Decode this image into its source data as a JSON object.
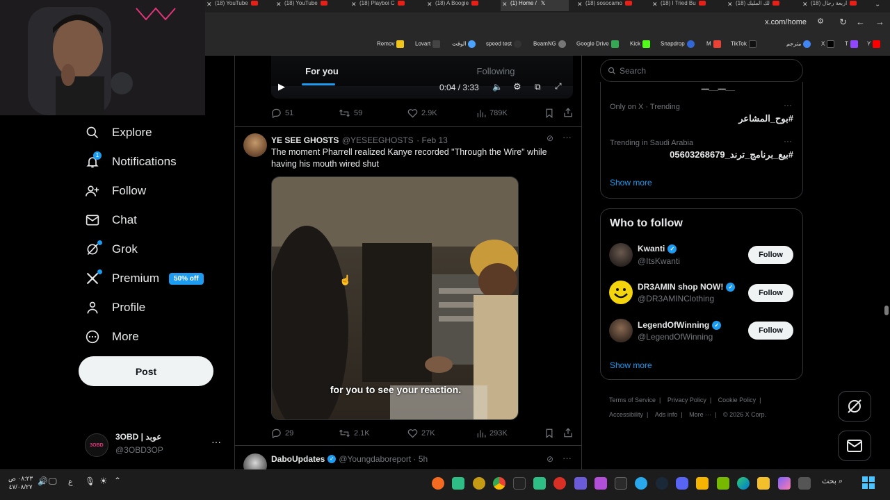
{
  "browser": {
    "tabs": [
      {
        "label": "(18) YouTube"
      },
      {
        "label": "(18) YouTube"
      },
      {
        "label": "(18) Playboi C"
      },
      {
        "label": "(18) A Boogie"
      },
      {
        "label": "(1) Home /"
      },
      {
        "label": "(18) sosocamo"
      },
      {
        "label": "(18) I Tried Bu"
      },
      {
        "label": "(18) لك المليك"
      },
      {
        "label": "(18) اربعة رجال"
      }
    ],
    "url": "x.com/home",
    "bookmarks": [
      {
        "label": "Remov",
        "color": "#f0c419"
      },
      {
        "label": "Lovart",
        "color": "#444444"
      },
      {
        "label": "الوقت",
        "color": "#4aa3ff"
      },
      {
        "label": "speed test",
        "color": "#333333"
      },
      {
        "label": "BeamNG",
        "color": "#777777"
      },
      {
        "label": "Google Drive",
        "color": "#34a853"
      },
      {
        "label": "Kick",
        "color": "#53fc18"
      },
      {
        "label": "Snapdrop",
        "color": "#3367d6"
      },
      {
        "label": "M",
        "color": "#ea4335"
      },
      {
        "label": "TikTok",
        "color": "#111111"
      },
      {
        "label": "مترجم",
        "color": "#4285f4"
      },
      {
        "label": "X",
        "color": "#000000"
      },
      {
        "label": "T",
        "color": "#9146ff"
      },
      {
        "label": "Y",
        "color": "#ff0000"
      }
    ]
  },
  "sidebar": {
    "items": [
      {
        "label": "Explore",
        "icon": "search-icon"
      },
      {
        "label": "Notifications",
        "icon": "bell-icon",
        "badge": "1"
      },
      {
        "label": "Follow",
        "icon": "person-add-icon"
      },
      {
        "label": "Chat",
        "icon": "mail-icon"
      },
      {
        "label": "Grok",
        "icon": "grok-icon"
      },
      {
        "label": "Premium",
        "icon": "x-logo-icon",
        "badge_text": "50% off"
      },
      {
        "label": "Profile",
        "icon": "person-icon"
      },
      {
        "label": "More",
        "icon": "more-circle-icon"
      }
    ],
    "post_label": "Post",
    "account": {
      "name": "3OBD | عوبد",
      "handle": "@3OBD3OP"
    }
  },
  "feed": {
    "tabs": [
      {
        "label": "For you"
      },
      {
        "label": "Following"
      }
    ],
    "player": {
      "time": "0:04 / 3:33"
    },
    "tweet0_actions": {
      "replies": "51",
      "reposts": "59",
      "likes": "2.9K",
      "views": "789K"
    },
    "tweet1": {
      "name": "YE SEE GHOSTS",
      "handle": "@YESEEGHOSTS",
      "date": "Feb 13",
      "text": "The moment Pharrell realized Kanye recorded \"Through the Wire\" while having his mouth wired shut",
      "caption": "for you to see your reaction.",
      "actions": {
        "replies": "29",
        "reposts": "2.1K",
        "likes": "27K",
        "views": "293K"
      }
    },
    "tweet2": {
      "name": "DaboUpdates",
      "handle": "@Youngdaboreport",
      "date": "5h"
    }
  },
  "right": {
    "search_placeholder": "Search",
    "trends": [
      {
        "context": "Only on X · Trending",
        "tag": "#بوح_المشاعر"
      },
      {
        "context": "Trending in Saudi Arabia",
        "tag": "#بيع_برنامج_ترند_05603268679"
      }
    ],
    "show_more": "Show more",
    "who_title": "Who to follow",
    "who": [
      {
        "name": "Kwanti",
        "handle": "@ItsKwanti",
        "button": "Follow"
      },
      {
        "name": "DR3AMIN shop NOW!",
        "handle": "@DR3AMINClothing",
        "button": "Follow"
      },
      {
        "name": "LegendOfWinning",
        "handle": "@LegendOfWinning",
        "button": "Follow"
      }
    ],
    "who_show_more": "Show more",
    "footer": [
      "Terms of Service",
      "Privacy Policy",
      "Cookie Policy",
      "Accessibility",
      "Ads info",
      "More ···",
      "© 2026 X Corp."
    ]
  },
  "taskbar": {
    "time": "٠٨:٢٣ ص",
    "date": "٤٧/٠٨/٢٧",
    "search_label": "بحث",
    "lang": "ع"
  },
  "colors": {
    "accent": "#1d9bf0",
    "background": "#000000",
    "border": "#2f3336",
    "muted": "#71767b"
  }
}
